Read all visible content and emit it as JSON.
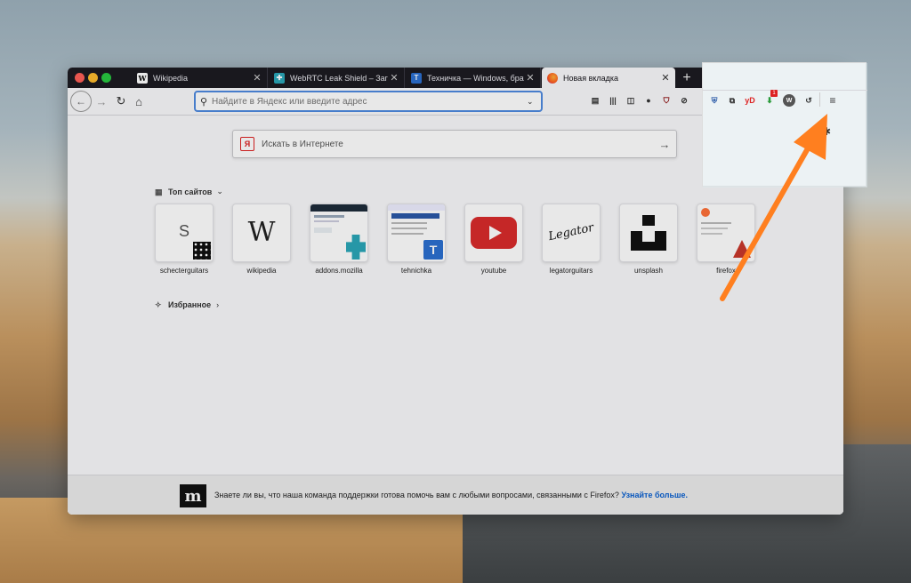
{
  "browser": {
    "tabs": [
      {
        "title": "Wikipedia",
        "favicon": "W",
        "close": "✕"
      },
      {
        "title": "WebRTC Leak Shield – Загрузи",
        "favicon": "puzzle",
        "close": "✕"
      },
      {
        "title": "Техничка — Windows, браузе",
        "favicon": "T",
        "close": "✕"
      },
      {
        "title": "Новая вкладка",
        "favicon": "firefox",
        "close": "✕"
      }
    ],
    "new_tab": "+",
    "address_placeholder": "Найдите в Яндекс или введите адрес",
    "toolbar_icons": [
      "downloads-icon",
      "library-icon",
      "sidebar-icon",
      "account-icon",
      "ublock-icon",
      "blocker-icon",
      "shield-icon",
      "screenshot-icon",
      "yandex-disk-icon",
      "extension-badge-icon",
      "wot-icon",
      "reload-icon",
      "menu-icon"
    ],
    "extension_badge": "1",
    "yd_label": "yD"
  },
  "newtab": {
    "search_placeholder": "Искать в Интернете",
    "search_logo": "Я",
    "top_sites_label": "Топ сайтов",
    "favorites_label": "Избранное",
    "sites": [
      {
        "name": "schecterguitars",
        "letter": "S"
      },
      {
        "name": "wikipedia",
        "letter": "W"
      },
      {
        "name": "addons.mozilla",
        "letter": ""
      },
      {
        "name": "tehnichka",
        "letter": "T"
      },
      {
        "name": "youtube",
        "letter": ""
      },
      {
        "name": "legatorguitars",
        "letter": "Legator"
      },
      {
        "name": "unsplash",
        "letter": ""
      },
      {
        "name": "firefox",
        "letter": ""
      }
    ]
  },
  "footer": {
    "logo": "m",
    "text": "Знаете ли вы, что наша команда поддержки готова помочь вам с любыми вопросами, связанными с Firefox?",
    "link": "Узнайте больше."
  },
  "colors": {
    "accent": "#ff7f1f",
    "link": "#0a60d0",
    "tabbar": "#1c1b22"
  }
}
